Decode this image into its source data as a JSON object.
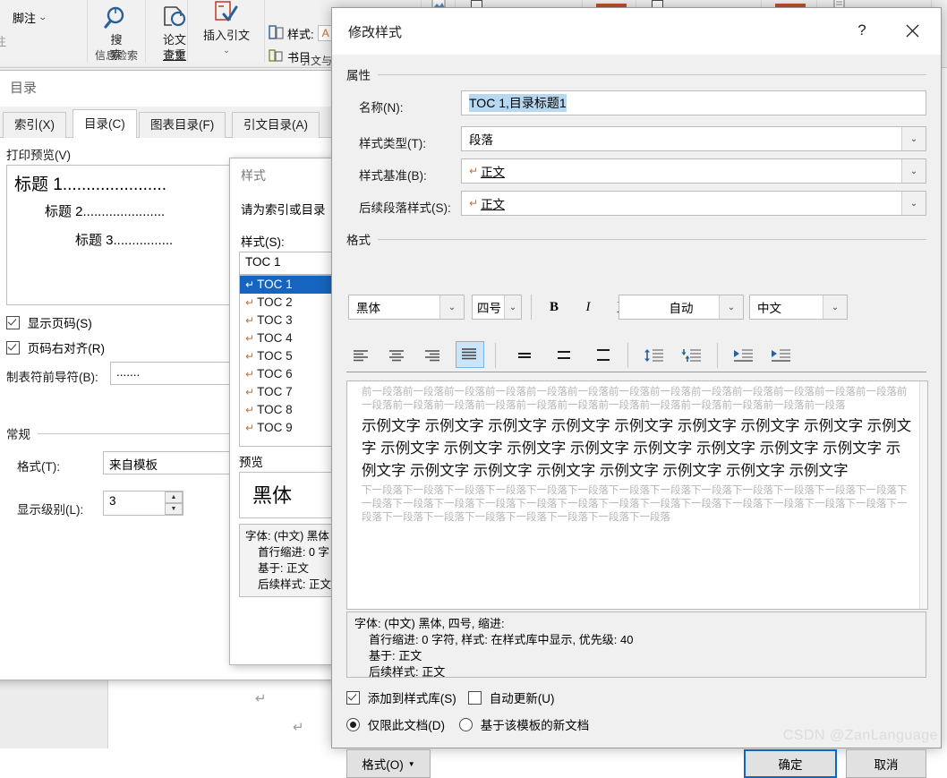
{
  "ribbon": {
    "left_items": [
      {
        "label": "脚注",
        "icon": "footnote-icon"
      },
      {
        "label": "注",
        "icon": "note-icon"
      }
    ],
    "groups": [
      {
        "label_line1": "搜",
        "label_line2": "索",
        "category": "信息检索",
        "icon": "search-icon"
      },
      {
        "label_line1": "论文",
        "label_line2": "查重",
        "category": "论文",
        "icon": "plagiarism-check-icon"
      },
      {
        "label_line1": "插入引文",
        "label_line2": "",
        "category": "引文与书目",
        "icon": "insert-citation-icon"
      }
    ],
    "style_label": "样式:",
    "style_value": "A",
    "bibliography_label": "书目"
  },
  "toc_dialog": {
    "title": "目录",
    "tabs": [
      {
        "label": "索引(X)",
        "active": false
      },
      {
        "label": "目录(C)",
        "active": true
      },
      {
        "label": "图表目录(F)",
        "active": false
      },
      {
        "label": "引文目录(A)",
        "active": false
      }
    ],
    "print_preview_label": "打印预览(V)",
    "preview_lines": [
      {
        "text": "标题  1",
        "dots": "......................",
        "indent": 0,
        "size": 19
      },
      {
        "text": "标题  2",
        "dots": "......................",
        "indent": 34,
        "size": 15
      },
      {
        "text": "标题  3",
        "dots": "................",
        "indent": 68,
        "size": 15
      }
    ],
    "show_page_numbers": {
      "label": "显示页码(S)",
      "checked": true
    },
    "right_align_page_numbers": {
      "label": "页码右对齐(R)",
      "checked": true
    },
    "tab_leader_label": "制表符前导符(B):",
    "tab_leader_value": ".......",
    "general_label": "常规",
    "format_label": "格式(T):",
    "format_value": "来自模板",
    "show_levels_label": "显示级别(L):",
    "show_levels_value": "3"
  },
  "styles_dialog": {
    "title": "样式",
    "prompt": "请为索引或目录",
    "styles_label": "样式(S):",
    "selected_value": "TOC 1",
    "items": [
      {
        "label": "TOC 1",
        "selected": true
      },
      {
        "label": "TOC 2",
        "selected": false
      },
      {
        "label": "TOC 3",
        "selected": false
      },
      {
        "label": "TOC 4",
        "selected": false
      },
      {
        "label": "TOC 5",
        "selected": false
      },
      {
        "label": "TOC 6",
        "selected": false
      },
      {
        "label": "TOC 7",
        "selected": false
      },
      {
        "label": "TOC 8",
        "selected": false
      },
      {
        "label": "TOC 9",
        "selected": false
      }
    ],
    "preview_label": "预览",
    "preview_text": "黑体",
    "description_lines": [
      "字体: (中文) 黑体",
      "首行缩进:  0 字",
      "基于: 正文",
      "后续样式: 正文"
    ]
  },
  "modify_dialog": {
    "title": "修改样式",
    "help_icon": "help-icon",
    "close_icon": "close-icon",
    "properties_group": "属性",
    "name_label": "名称(N):",
    "name_value": "TOC 1,目录标题1",
    "style_type_label": "样式类型(T):",
    "style_type_value": "段落",
    "style_based_on_label": "样式基准(B):",
    "style_based_on_value": "正文",
    "next_style_label": "后续段落样式(S):",
    "next_style_value": "正文",
    "format_group": "格式",
    "font_name": "黑体",
    "font_size": "四号",
    "bold_label": "B",
    "italic_label": "I",
    "underline_label": "U",
    "font_color": "自动",
    "language": "中文",
    "align_buttons": [
      {
        "name": "align-left-button",
        "active": false
      },
      {
        "name": "align-center-button",
        "active": false
      },
      {
        "name": "align-right-button",
        "active": false
      },
      {
        "name": "align-justify-button",
        "active": true
      }
    ],
    "spacing_buttons": [
      {
        "name": "line-spacing-single-button"
      },
      {
        "name": "line-spacing-1-5-button"
      },
      {
        "name": "line-spacing-double-button"
      }
    ],
    "para_spacing_buttons": [
      {
        "name": "increase-paragraph-spacing-button"
      },
      {
        "name": "decrease-paragraph-spacing-button"
      }
    ],
    "indent_buttons": [
      {
        "name": "decrease-indent-button"
      },
      {
        "name": "increase-indent-button"
      }
    ],
    "preview": {
      "before_text": "前一段落前一段落前一段落前一段落前一段落前一段落前一段落前一段落前一段落前一段落前一段落前一段落前一段落前一段落前一段落前一段落前一段落前一段落前一段落前一段落前一段落前一段落前一段落前一段落前一段落",
      "sample_text": "示例文字 示例文字 示例文字 示例文字 示例文字 示例文字 示例文字 示例文字 示例文字 示例文字 示例文字 示例文字 示例文字 示例文字 示例文字 示例文字 示例文字 示例文字 示例文字 示例文字 示例文字 示例文字 示例文字 示例文字 示例文字",
      "after_text": "下一段落下一段落下一段落下一段落下一段落下一段落下一段落下一段落下一段落下一段落下一段落下一段落下一段落下一段落下一段落下一段落下一段落下一段落下一段落下一段落下一段落下一段落下一段落下一段落下一段落下一段落下一段落下一段落下一段落下一段落下一段落下一段落下一段落下一段落"
    },
    "description_lines": [
      "字体: (中文) 黑体, 四号, 缩进:",
      "首行缩进:  0 字符, 样式: 在样式库中显示, 优先级: 40",
      "基于: 正文",
      "后续样式: 正文"
    ],
    "add_to_gallery": {
      "label": "添加到样式库(S)",
      "checked": true
    },
    "auto_update": {
      "label": "自动更新(U)",
      "checked": false
    },
    "only_this_document": {
      "label": "仅限此文档(D)",
      "selected": true
    },
    "new_documents_from_template": {
      "label": "基于该模板的新文档",
      "selected": false
    },
    "format_button": "格式(O)",
    "ok_button": "确定",
    "cancel_button": "取消"
  },
  "watermark": "CSDN @ZanLanguage",
  "colors": {
    "accent_blue": "#1565c0",
    "primary_border": "#0a68c4",
    "selection": "#b8d7f0",
    "dialog_bg": "#f0f0f0"
  }
}
